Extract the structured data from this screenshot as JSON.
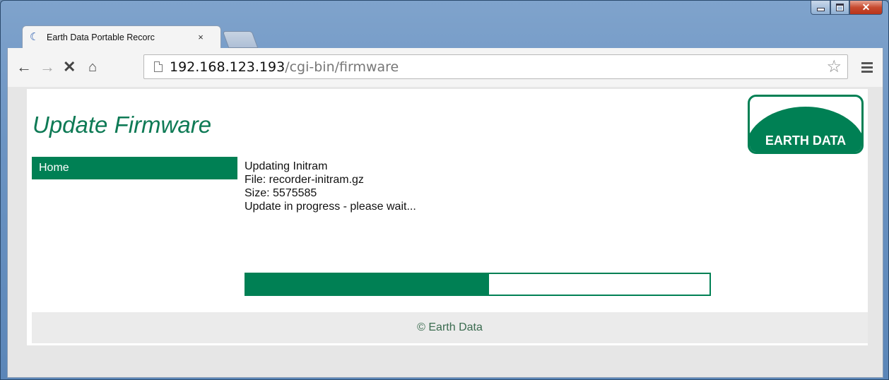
{
  "browser": {
    "tab_title": "Earth Data Portable Recorc",
    "tab_close": "×",
    "url_host": "192.168.123.193",
    "url_path": "/cgi-bin/firmware",
    "icons": [
      "back-icon",
      "forward-icon",
      "stop-icon",
      "home-icon",
      "page-icon",
      "bookmark-star-icon",
      "menu-icon"
    ]
  },
  "page": {
    "title": "Update Firmware",
    "logo_text": "EARTH DATA",
    "nav": {
      "home": "Home"
    },
    "status": {
      "line1": "Updating Initram",
      "line2": "File: recorder-initram.gz",
      "line3": "Size: 5575585",
      "line4": "Update in progress - please wait..."
    },
    "progress_fraction": 0.525,
    "footer": "© Earth Data"
  },
  "colors": {
    "brand_green": "#008054",
    "title_green": "#0e7a55"
  }
}
